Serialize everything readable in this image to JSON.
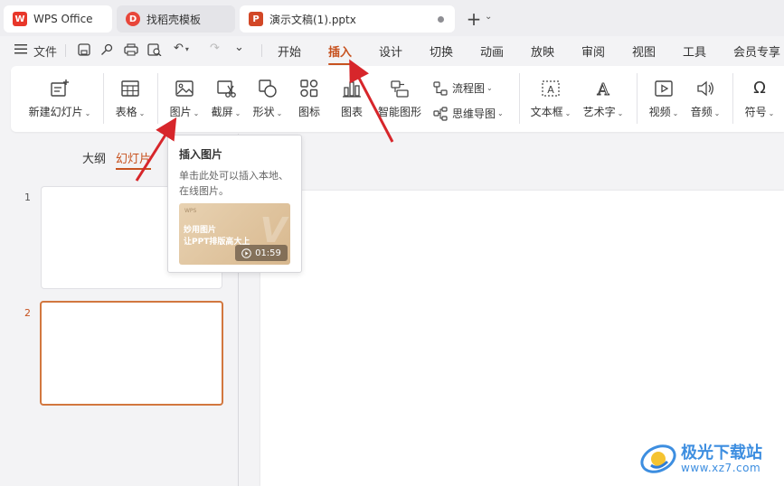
{
  "tabs": {
    "wps": "WPS Office",
    "templates": "找稻壳模板",
    "document": "演示文稿(1).pptx"
  },
  "menubar": {
    "file": "文件",
    "items": [
      "开始",
      "插入",
      "设计",
      "切换",
      "动画",
      "放映",
      "审阅",
      "视图",
      "工具",
      "会员专享"
    ],
    "active": "插入"
  },
  "ribbon": {
    "new_slide": "新建幻灯片",
    "table": "表格",
    "picture": "图片",
    "screenshot": "截屏",
    "shape": "形状",
    "icon": "图标",
    "chart": "图表",
    "smart_art": "智能图形",
    "flowchart": "流程图",
    "mindmap": "思维导图",
    "textbox": "文本框",
    "wordart": "艺术字",
    "video": "视频",
    "audio": "音频",
    "symbol": "符号"
  },
  "panel": {
    "outline": "大纲",
    "slides": "幻灯片",
    "slide_numbers": [
      "1",
      "2"
    ]
  },
  "tooltip": {
    "title": "插入图片",
    "description": "单击此处可以插入本地、在线图片。",
    "video_line1": "妙用图片",
    "video_line2": "让PPT排版高大上",
    "duration": "01:59"
  },
  "watermark": {
    "name": "极光下载站",
    "url": "www.xz7.com"
  },
  "colors": {
    "accent": "#c7521f",
    "arrow": "#d7262b",
    "selected_border": "#d2773f"
  }
}
